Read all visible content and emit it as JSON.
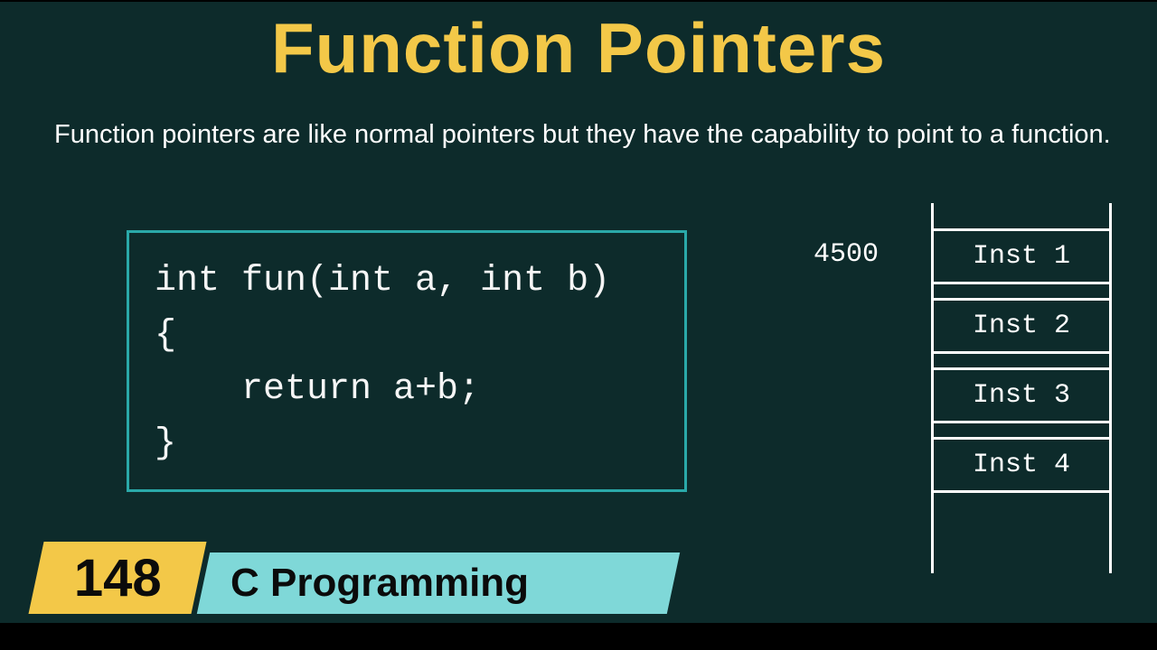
{
  "title": "Function Pointers",
  "description": "Function pointers are like normal pointers but they have the capability to point to a function.",
  "code": {
    "line1": "int fun(int a, int b)",
    "line2": "{",
    "line3": "    return a+b;",
    "line4": "}"
  },
  "memory": {
    "address": "4500",
    "cells": [
      "Inst 1",
      "Inst 2",
      "Inst 3",
      "Inst 4"
    ]
  },
  "episode": "148",
  "course": "C Programming"
}
